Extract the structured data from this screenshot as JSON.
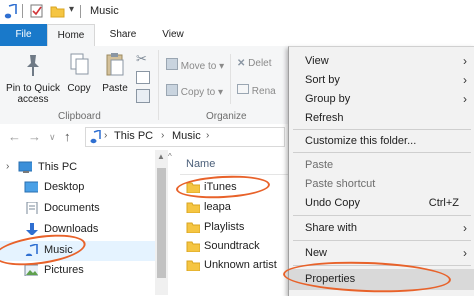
{
  "window": {
    "title": "Music"
  },
  "ribbon": {
    "tabs": [
      "File",
      "Home",
      "Share",
      "View"
    ],
    "clipboard": {
      "pin_label": "Pin to Quick access",
      "copy_label": "Copy",
      "paste_label": "Paste",
      "group_label": "Clipboard"
    },
    "organize": {
      "move_to": "Move to",
      "copy_to": "Copy to",
      "delete": "Delet",
      "rename": "Rena",
      "group_label": "Organize"
    }
  },
  "address": {
    "crumbs": [
      "This PC",
      "Music"
    ]
  },
  "nav": {
    "items": [
      "This PC",
      "Desktop",
      "Documents",
      "Downloads",
      "Music",
      "Pictures"
    ]
  },
  "files": {
    "column_name": "Name",
    "items": [
      "iTunes",
      "leapa",
      "Playlists",
      "Soundtrack",
      "Unknown artist"
    ]
  },
  "context_menu": {
    "view": "View",
    "sort_by": "Sort by",
    "group_by": "Group by",
    "refresh": "Refresh",
    "customize": "Customize this folder...",
    "paste": "Paste",
    "paste_shortcut": "Paste shortcut",
    "undo_copy": "Undo Copy",
    "undo_shortcut": "Ctrl+Z",
    "share_with": "Share with",
    "new": "New",
    "properties": "Properties"
  },
  "colors": {
    "file_tab": "#1979ca",
    "annotation": "#e8622a",
    "folder": "#f5c542",
    "music_note": "#2f6fd1"
  }
}
